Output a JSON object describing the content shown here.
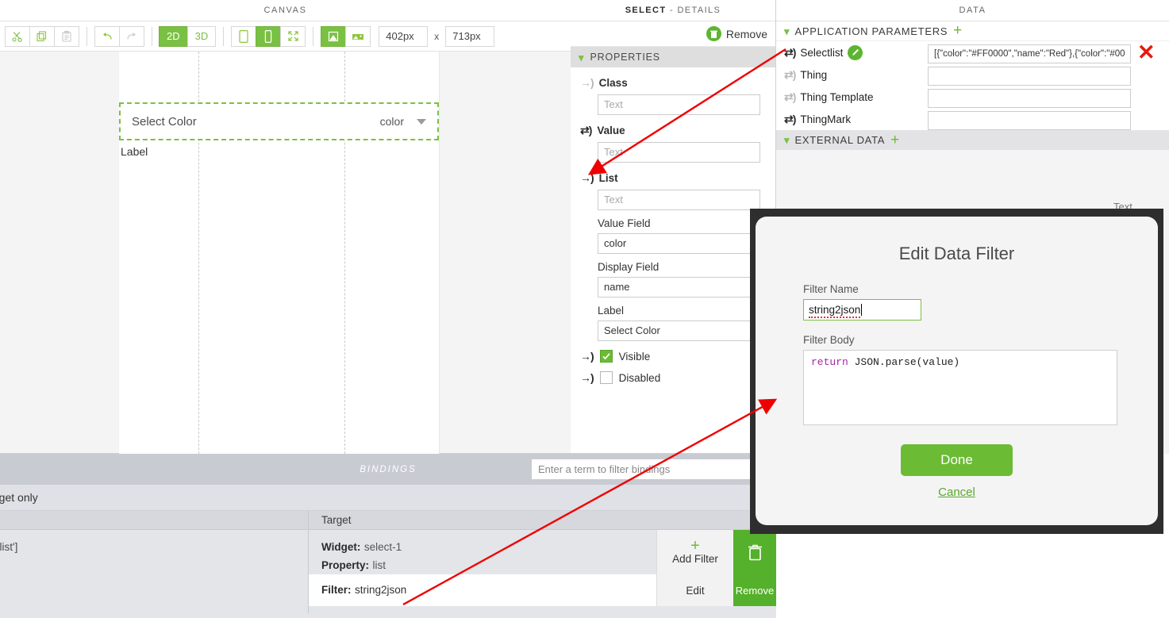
{
  "canvas": {
    "title": "CANVAS",
    "toolbar": {
      "cut_label": "scissors-icon",
      "copy_label": "copy-icon",
      "paste_label": "paste-icon",
      "undo_label": "undo-icon",
      "redo_label": "redo-icon",
      "view_2d": "2D",
      "view_3d": "3D",
      "width_value": "402px",
      "x_sep": "x",
      "height_value": "713px"
    },
    "widget": {
      "label": "Select Color",
      "value": "color"
    },
    "page_label": "Label"
  },
  "details": {
    "header_bold": "SELECT",
    "header_rest": " - DETAILS",
    "remove_label": "Remove",
    "section_properties": "PROPERTIES",
    "properties": [
      {
        "name": "Class",
        "placeholder": "Text",
        "value": "",
        "bind": "one-way"
      },
      {
        "name": "Value",
        "placeholder": "Text",
        "value": "",
        "bind": "two-way"
      },
      {
        "name": "List",
        "placeholder": "Text",
        "value": "",
        "bind": "one-way-bold"
      }
    ],
    "fields": [
      {
        "name": "Value Field",
        "value": "color"
      },
      {
        "name": "Display Field",
        "value": "name"
      },
      {
        "name": "Label",
        "value": "Select Color"
      }
    ],
    "checkboxes": [
      {
        "name": "Visible",
        "checked": true
      },
      {
        "name": "Disabled",
        "checked": false
      }
    ]
  },
  "data": {
    "title": "DATA",
    "section_app_params": "APPLICATION PARAMETERS",
    "section_external": "EXTERNAL DATA",
    "add_symbol": "+",
    "remove_symbol": "✕",
    "rows": [
      {
        "name": "Selectlist",
        "value": "[{\"color\":\"#FF0000\",\"name\":\"Red\"},{\"color\":\"#00",
        "edited": true
      },
      {
        "name": "Thing",
        "value": "",
        "edited": false
      },
      {
        "name": "Thing Template",
        "value": "",
        "edited": false
      },
      {
        "name": "ThingMark",
        "value": "",
        "edited": false
      }
    ],
    "ghost_text": "Text"
  },
  "bindings": {
    "title": "BINDINGS",
    "filter_placeholder": "Enter a term to filter bindings",
    "subbar_text": "d widget only",
    "col_source": "",
    "col_target": "Target",
    "source_text": "Selectlist']",
    "target": {
      "widget_label": "Widget:",
      "widget_value": "select-1",
      "property_label": "Property:",
      "property_value": "list",
      "add_filter_label": "Add Filter",
      "add_filter_symbol": "+",
      "delete_label": "trash-icon",
      "filter_label": "Filter:",
      "filter_value": "string2json",
      "edit_label": "Edit",
      "remove_label": "Remove"
    }
  },
  "modal": {
    "title": "Edit Data Filter",
    "filter_name_label": "Filter Name",
    "filter_name_value": "string2json",
    "filter_body_label": "Filter Body",
    "filter_body_keyword": "return",
    "filter_body_rest": " JSON.parse(value)",
    "done_label": "Done",
    "cancel_label": "Cancel"
  },
  "colors": {
    "accent_green": "#7ac143",
    "button_green": "#6cbb35",
    "alert_red": "#e8190c",
    "annotation_red": "#ef0000"
  }
}
